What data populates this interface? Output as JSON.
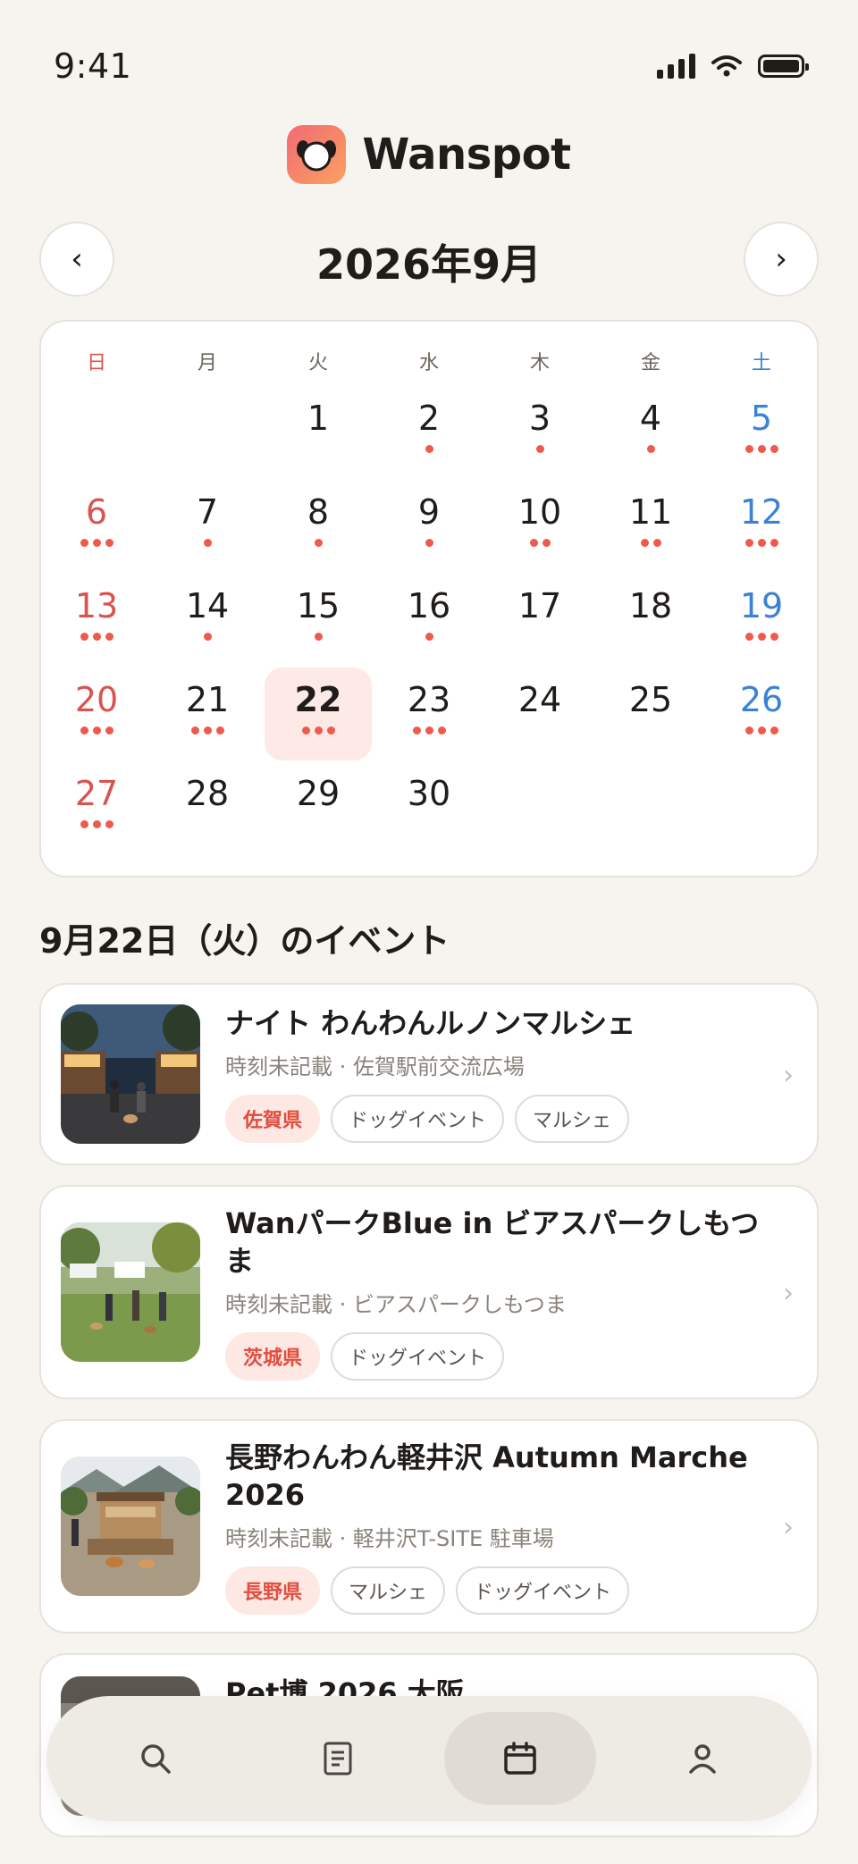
{
  "status": {
    "time": "9:41"
  },
  "app": {
    "name": "Wanspot"
  },
  "calendar": {
    "month_title": "2026年9月",
    "prev_label": "‹",
    "next_label": "›",
    "weekdays": [
      "日",
      "月",
      "火",
      "水",
      "木",
      "金",
      "土"
    ],
    "weeks": [
      [
        null,
        null,
        {
          "day": "1",
          "dots": 0
        },
        {
          "day": "2",
          "dots": 1
        },
        {
          "day": "3",
          "dots": 1
        },
        {
          "day": "4",
          "dots": 1
        },
        {
          "day": "5",
          "dots": 3
        }
      ],
      [
        {
          "day": "6",
          "dots": 3
        },
        {
          "day": "7",
          "dots": 1
        },
        {
          "day": "8",
          "dots": 1
        },
        {
          "day": "9",
          "dots": 1
        },
        {
          "day": "10",
          "dots": 2
        },
        {
          "day": "11",
          "dots": 2
        },
        {
          "day": "12",
          "dots": 3
        }
      ],
      [
        {
          "day": "13",
          "dots": 3
        },
        {
          "day": "14",
          "dots": 1
        },
        {
          "day": "15",
          "dots": 1
        },
        {
          "day": "16",
          "dots": 1
        },
        {
          "day": "17",
          "dots": 0
        },
        {
          "day": "18",
          "dots": 0
        },
        {
          "day": "19",
          "dots": 3
        }
      ],
      [
        {
          "day": "20",
          "dots": 3
        },
        {
          "day": "21",
          "dots": 3
        },
        {
          "day": "22",
          "dots": 3,
          "selected": true
        },
        {
          "day": "23",
          "dots": 3
        },
        {
          "day": "24",
          "dots": 0
        },
        {
          "day": "25",
          "dots": 0
        },
        {
          "day": "26",
          "dots": 3
        }
      ],
      [
        {
          "day": "27",
          "dots": 3
        },
        {
          "day": "28",
          "dots": 0
        },
        {
          "day": "29",
          "dots": 0
        },
        {
          "day": "30",
          "dots": 0
        },
        null,
        null,
        null
      ]
    ]
  },
  "events_section": {
    "title": "9月22日（火）のイベント",
    "events": [
      {
        "title": "ナイト わんわんルノンマルシェ",
        "meta": "時刻未記載 · 佐賀駅前交流広場",
        "tags": [
          "佐賀県",
          "ドッグイベント",
          "マルシェ"
        ]
      },
      {
        "title": "WanパークBlue in ビアスパークしもつま",
        "meta": "時刻未記載 · ビアスパークしもつま",
        "tags": [
          "茨城県",
          "ドッグイベント"
        ]
      },
      {
        "title": "長野わんわん軽井沢 Autumn Marche 2026",
        "meta": "時刻未記載 · 軽井沢T-SITE 駐車場",
        "tags": [
          "長野県",
          "マルシェ",
          "ドッグイベント"
        ]
      },
      {
        "title": "Pet博 2026 大阪",
        "meta": "",
        "tags": []
      }
    ]
  },
  "tab_bar": {
    "tabs": [
      {
        "name": "search",
        "icon": "search-icon"
      },
      {
        "name": "list",
        "icon": "document-icon"
      },
      {
        "name": "calendar",
        "icon": "calendar-icon",
        "active": true
      },
      {
        "name": "profile",
        "icon": "user-icon"
      }
    ]
  },
  "colors": {
    "accent": "#ef5a4d",
    "sunday": "#d9534f",
    "saturday": "#3a82d6",
    "background": "#f6f4ef"
  }
}
